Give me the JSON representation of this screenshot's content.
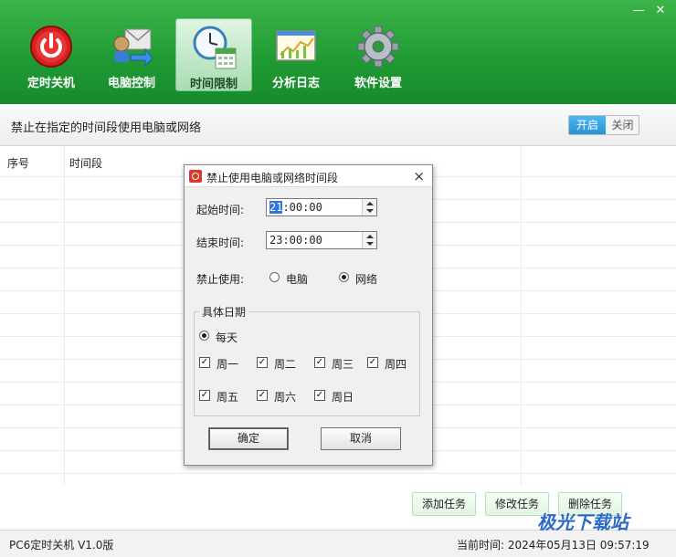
{
  "window": {
    "minimize": "—",
    "close": "✕"
  },
  "nav": [
    {
      "label": "定时关机",
      "icon": "power-icon",
      "active": false
    },
    {
      "label": "电脑控制",
      "icon": "computer-mail-icon",
      "active": false
    },
    {
      "label": "时间限制",
      "icon": "clock-calendar-icon",
      "active": true
    },
    {
      "label": "分析日志",
      "icon": "chart-log-icon",
      "active": false
    },
    {
      "label": "软件设置",
      "icon": "gear-icon",
      "active": false
    }
  ],
  "subtitle": "禁止在指定的时间段使用电脑或网络",
  "toggle": {
    "on": "开启",
    "off": "关闭"
  },
  "table": {
    "columns": [
      "序号",
      "时间段"
    ]
  },
  "actions": {
    "add": "添加任务",
    "edit": "修改任务",
    "delete": "删除任务"
  },
  "status": {
    "app": "PC6定时关机 V1.0版",
    "time_label": "当前时间:",
    "time_value": "2024年05月13日 09:57:19"
  },
  "watermark": "极光下载站",
  "dialog": {
    "title": "禁止使用电脑或网络时间段",
    "close": "×",
    "start_label": "起始时间:",
    "start_hour": "21",
    "start_rest": ":00:00",
    "end_label": "结束时间:",
    "end_value": "23:00:00",
    "use_label": "禁止使用:",
    "opt_pc": "电脑",
    "opt_net": "网络",
    "group_title": "具体日期",
    "everyday": "每天",
    "days": [
      "周一",
      "周二",
      "周三",
      "周四",
      "周五",
      "周六",
      "周日"
    ],
    "ok": "确定",
    "cancel": "取消"
  },
  "colors": {
    "header_green": "#1f9a33",
    "toggle_blue": "#2793d6"
  }
}
